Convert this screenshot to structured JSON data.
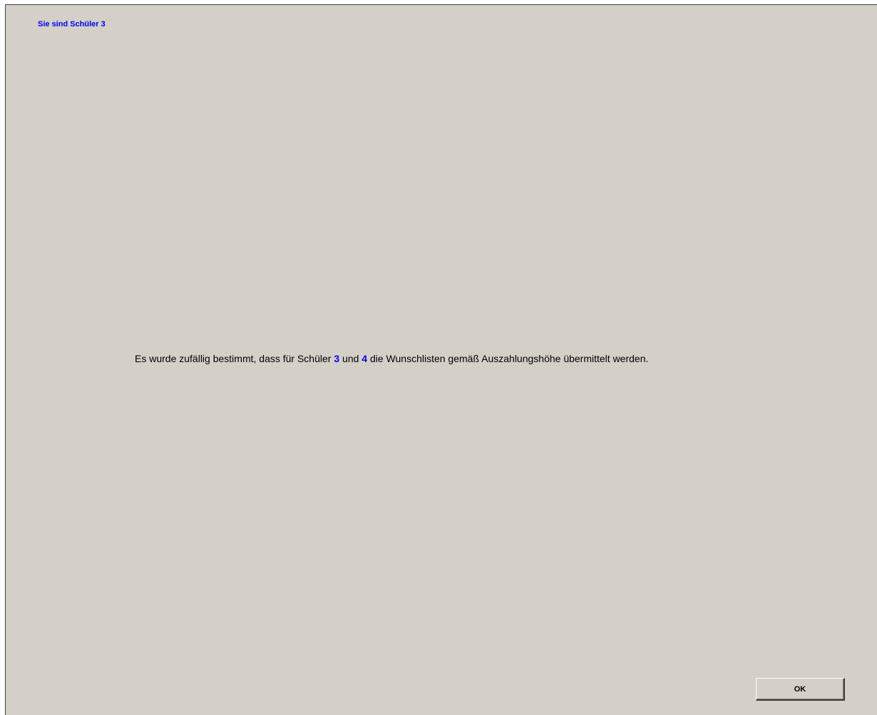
{
  "header": {
    "user_label": "Sie sind Schüler 3"
  },
  "main": {
    "message_part1": "Es wurde zufällig bestimmt, dass für Schüler ",
    "student_a": "3",
    "message_part2": " und ",
    "student_b": "4",
    "message_part3": " die Wunschlisten gemäß Auszahlungshöhe übermittelt werden."
  },
  "footer": {
    "ok_label": "OK"
  },
  "colors": {
    "background": "#d4d0c8",
    "accent": "#0000ff",
    "text": "#000000"
  }
}
